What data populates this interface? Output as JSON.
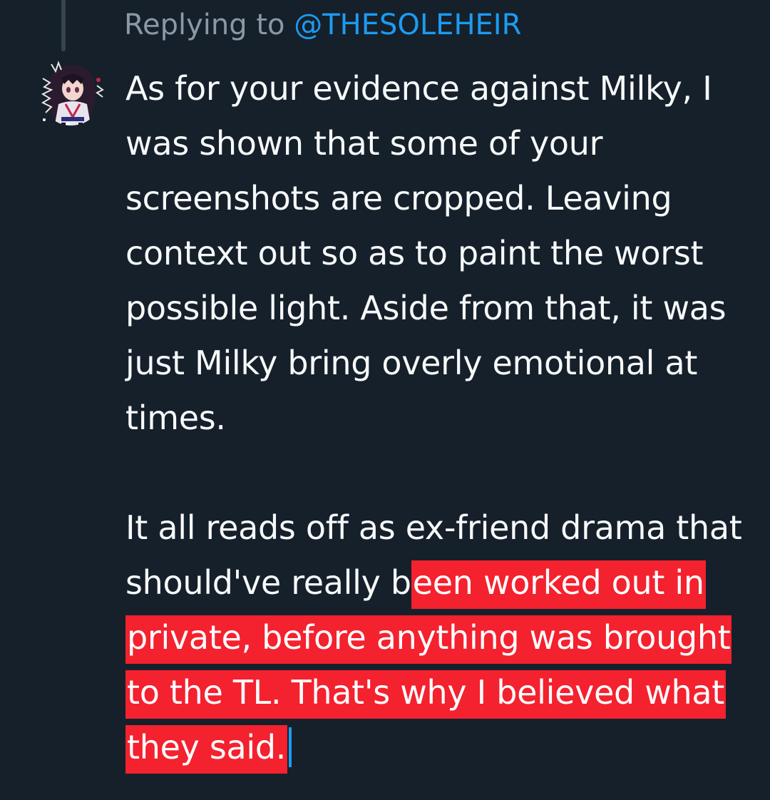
{
  "reply": {
    "prefix": "Replying to",
    "handle": "@THESOLEHEIR"
  },
  "tweet": {
    "paragraph1": "As for your evidence against Milky, I was shown that some of your screenshots are cropped. Leaving context out so as to paint the worst possible light. Aside from that, it was just Milky bring overly emotional at times.",
    "paragraph2_plain": "It all reads off as ex-friend drama that should've really b",
    "paragraph2_highlighted": "een worked out in private, before anything was brought to the TL. That's why I believed what they said."
  },
  "colors": {
    "background": "#15202b",
    "text": "#f7f9f9",
    "secondary_text": "#8b98a5",
    "accent": "#1d9bf0",
    "highlight": "#f4212e",
    "thread_line": "#38444d"
  },
  "icons": {
    "avatar": "anime-character-avatar"
  }
}
